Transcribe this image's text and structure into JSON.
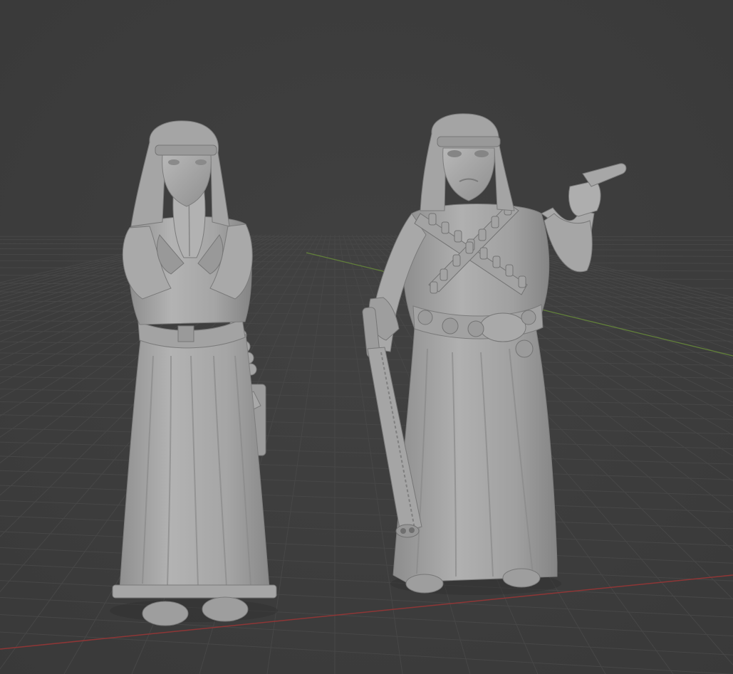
{
  "viewport": {
    "mode": "3d-viewport",
    "shading": "solid",
    "background_color": "#3d3d3d",
    "grid_color": "#4a4a4a",
    "x_axis_color": "#9a3a3a",
    "y_axis_color": "#6e8a3a",
    "model_color": "#a9a9a9"
  },
  "objects": [
    {
      "icon": "praying-nun-figure"
    },
    {
      "icon": "armed-nun-figure"
    }
  ]
}
